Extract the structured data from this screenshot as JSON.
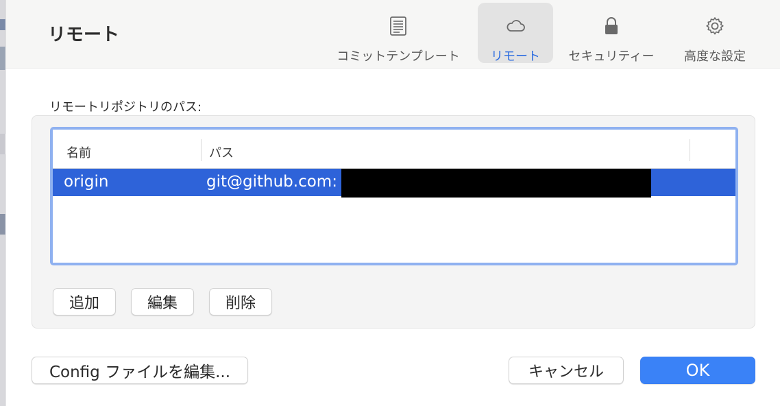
{
  "window": {
    "title": "リモート"
  },
  "toolbar": {
    "tabs": [
      {
        "label": "コミットテンプレート",
        "icon": "document-lines-icon"
      },
      {
        "label": "リモート",
        "icon": "cloud-icon",
        "selected": true
      },
      {
        "label": "セキュリティー",
        "icon": "lock-icon"
      },
      {
        "label": "高度な設定",
        "icon": "gear-icon"
      }
    ]
  },
  "remotes": {
    "label": "リモートリポジトリのパス:",
    "columns": [
      "名前",
      "パス"
    ],
    "rows": [
      {
        "name": "origin",
        "path": "git@github.com:",
        "selected": true
      }
    ],
    "buttons": {
      "add": "追加",
      "edit": "編集",
      "delete": "削除"
    }
  },
  "footer": {
    "config_button": "Config ファイルを編集...",
    "cancel_button": "キャンセル",
    "ok_button": "OK"
  },
  "colors": {
    "accent": "#3a82f7",
    "selection": "#2e63d9",
    "focus_ring": "#8fb1f0",
    "active_tab_text": "#2f6ee0"
  }
}
